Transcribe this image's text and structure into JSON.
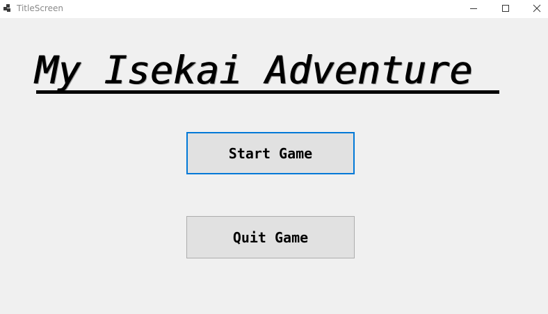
{
  "window": {
    "title": "TitleScreen"
  },
  "controls": {
    "minimize_icon": "minimize-icon",
    "maximize_icon": "maximize-icon",
    "close_icon": "close-icon"
  },
  "main": {
    "game_title": "My Isekai Adventure",
    "start_button": "Start Game",
    "quit_button": "Quit Game"
  },
  "colors": {
    "focus_border": "#0078d7",
    "button_bg": "#e1e1e1",
    "window_bg": "#f0f0f0"
  }
}
